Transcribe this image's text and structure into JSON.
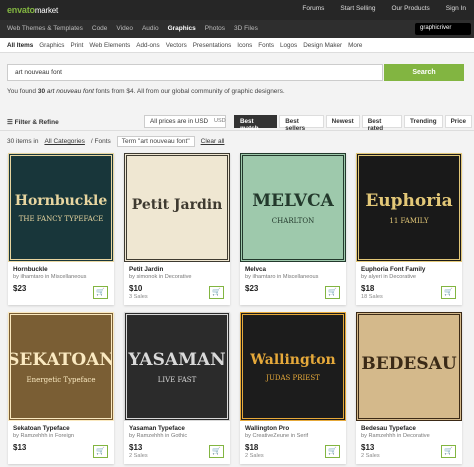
{
  "topbar": {
    "logo_brand": "envato",
    "logo_market": "market",
    "links": [
      "Forums",
      "Start Selling",
      "Our Products",
      "Sign In"
    ]
  },
  "categories": [
    "Web Themes & Templates",
    "Code",
    "Video",
    "Audio",
    "Graphics",
    "Photos",
    "3D Files"
  ],
  "active_category": "Graphics",
  "site_badge": "graphicriver",
  "subnav": [
    "All Items",
    "Graphics",
    "Print",
    "Web Elements",
    "Add-ons",
    "Vectors",
    "Presentations",
    "Icons",
    "Fonts",
    "Logos",
    "Design Maker",
    "More"
  ],
  "search": {
    "value": "art nouveau font",
    "button": "Search"
  },
  "found": {
    "pre": "You found ",
    "count": "30",
    "term": "art nouveau font",
    "post": " fonts from $4. All from our global community of graphic designers."
  },
  "filter": {
    "label": "Filter & Refine",
    "prices": "All prices are in USD",
    "currency": "USD",
    "sorts": [
      "Best match",
      "Best sellers",
      "Newest",
      "Best rated",
      "Trending",
      "Price"
    ],
    "active_sort": "Best match"
  },
  "countbar": {
    "items": "30 items in",
    "link": "All Categories",
    "path": "/ Fonts",
    "term": "Term \"art nouveau font\"",
    "clear": "Clear all"
  },
  "colors": {
    "accent": "#82b541",
    "topbar": "#262626"
  },
  "items": [
    {
      "title": "Hornbuckle",
      "author": "by ilhamtaro in Miscellaneous",
      "price": "$23",
      "sales": "",
      "art": "Hornbuckle",
      "art_sub": "THE FANCY TYPEFACE",
      "bg": "#18363a",
      "fg": "#e8d6a0"
    },
    {
      "title": "Petit Jardin",
      "author": "by simonok in Decorative",
      "price": "$10",
      "sales": "3 Sales",
      "art": "Petit Jardin",
      "art_sub": "",
      "bg": "#efe7d2",
      "fg": "#3e3a30"
    },
    {
      "title": "Melvca",
      "author": "by ilhamtaro in Miscellaneous",
      "price": "$23",
      "sales": "",
      "art": "MELVCA",
      "art_sub": "CHARLTON",
      "bg": "#9ec9ac",
      "fg": "#23392c"
    },
    {
      "title": "Euphoria Font Family",
      "author": "by alyeri in Decorative",
      "price": "$18",
      "sales": "18 Sales",
      "art": "Euphoria",
      "art_sub": "11 FAMILY",
      "bg": "#191919",
      "fg": "#e3c878"
    },
    {
      "title": "Sekatoan Typeface",
      "author": "by Ramzehhh in Foreign",
      "price": "$13",
      "sales": "",
      "art": "SEKATOAN",
      "art_sub": "Energetic Typeface",
      "bg": "#7a5e34",
      "fg": "#fae9c0"
    },
    {
      "title": "Yasaman Typeface",
      "author": "by Ramzehhh in Gothic",
      "price": "$13",
      "sales": "2 Sales",
      "art": "YASAMAN",
      "art_sub": "LIVE FAST",
      "bg": "#2b2b2b",
      "fg": "#d9d9d9"
    },
    {
      "title": "Wallington Pro",
      "author": "by CreativeZeune in Serif",
      "price": "$18",
      "sales": "2 Sales",
      "art": "Wallington",
      "art_sub": "JUDAS PRIEST",
      "bg": "#1c1c1c",
      "fg": "#e6a93a"
    },
    {
      "title": "Bedesau Typeface",
      "author": "by Ramzehhh in Decorative",
      "price": "$13",
      "sales": "2 Sales",
      "art": "BEDESAU",
      "art_sub": "",
      "bg": "#d4b98b",
      "fg": "#3b2a17"
    }
  ]
}
